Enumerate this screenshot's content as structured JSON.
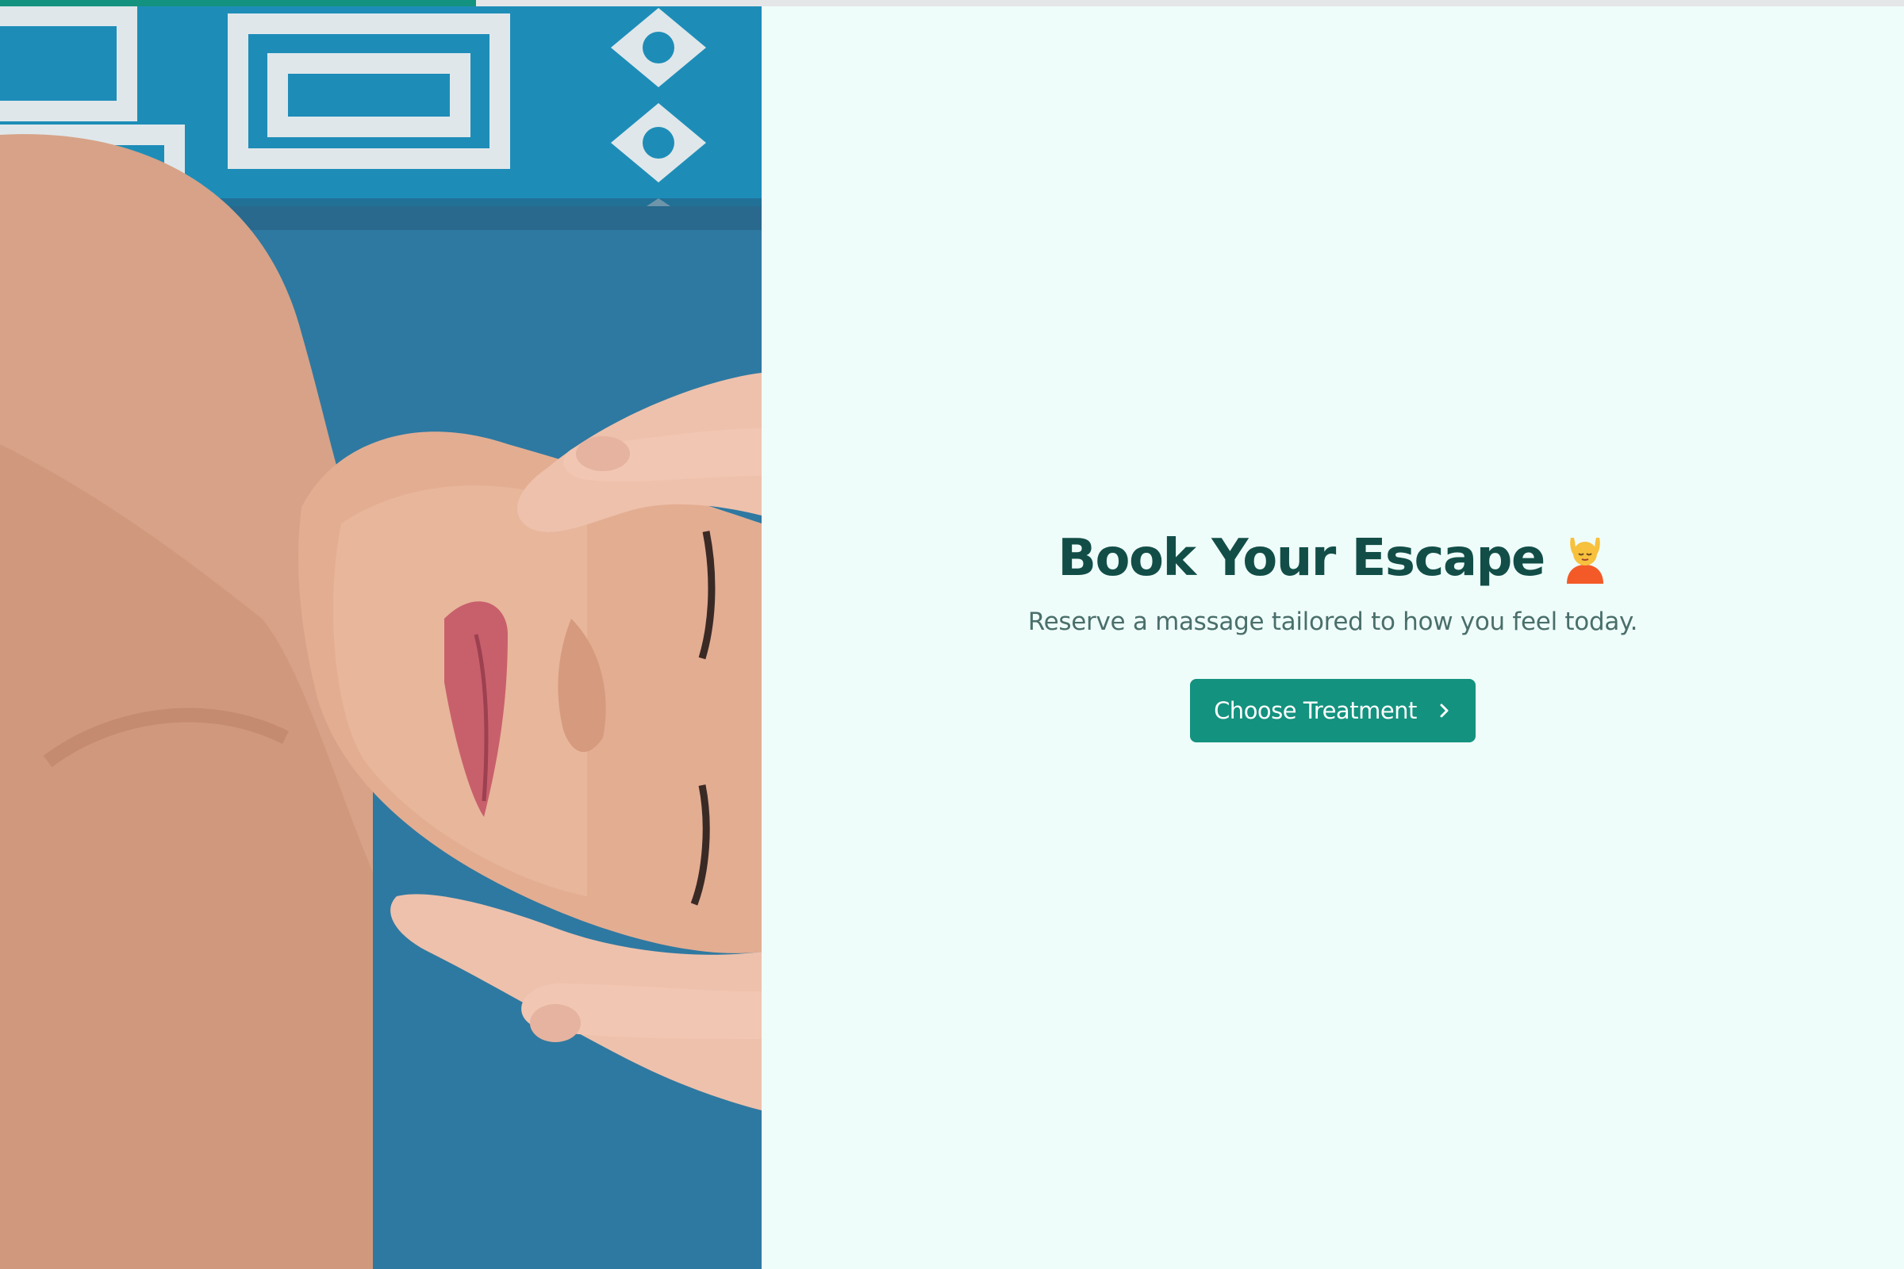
{
  "progress": {
    "fraction": 0.25,
    "fill_color": "#13927f"
  },
  "photo": {
    "alt": "Person receiving a relaxing head and face massage on a blue cushion",
    "icon": "massage-photo"
  },
  "hero": {
    "title": "Book Your Escape",
    "title_emoji_icon": "person-getting-massage-icon",
    "subtitle": "Reserve a massage tailored to how you feel today.",
    "cta_label": "Choose Treatment",
    "cta_icon": "chevron-right-icon"
  },
  "colors": {
    "accent": "#13927f",
    "title": "#124e47",
    "subtitle": "#4a6f6b",
    "background": "#effdfa",
    "cushion": "#2b7aa3"
  }
}
